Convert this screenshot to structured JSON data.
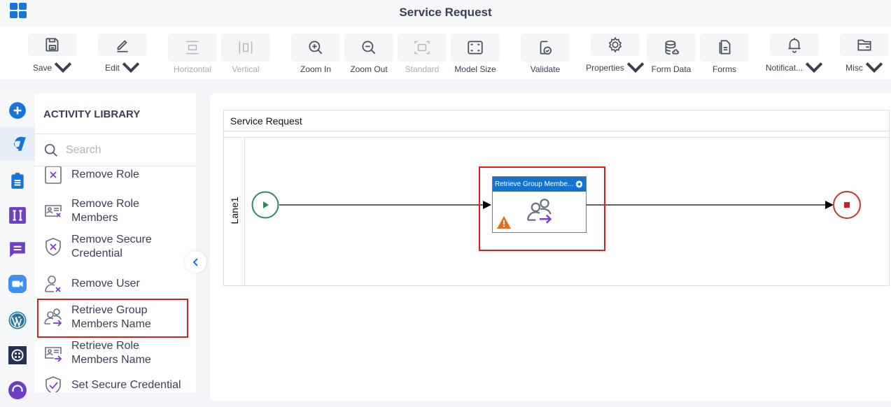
{
  "header": {
    "title": "Service Request",
    "logo_icon": "app-grid-icon"
  },
  "toolbar": {
    "buttons": [
      {
        "label": "Save",
        "icon": "save-icon",
        "dropdown": true,
        "disabled": false
      },
      {
        "label": "Edit",
        "icon": "edit-icon",
        "dropdown": true,
        "disabled": false
      },
      {
        "label": "Horizontal",
        "icon": "horizontal-layout-icon",
        "dropdown": false,
        "disabled": true
      },
      {
        "label": "Vertical",
        "icon": "vertical-layout-icon",
        "dropdown": false,
        "disabled": true
      },
      {
        "label": "Zoom In",
        "icon": "zoom-in-icon",
        "dropdown": false,
        "disabled": false
      },
      {
        "label": "Zoom Out",
        "icon": "zoom-out-icon",
        "dropdown": false,
        "disabled": false
      },
      {
        "label": "Standard",
        "icon": "standard-size-icon",
        "dropdown": false,
        "disabled": true
      },
      {
        "label": "Model Size",
        "icon": "model-size-icon",
        "dropdown": false,
        "disabled": false
      },
      {
        "label": "Validate",
        "icon": "validate-icon",
        "dropdown": false,
        "disabled": false
      },
      {
        "label": "Properties",
        "icon": "gear-icon",
        "dropdown": true,
        "disabled": false
      },
      {
        "label": "Form Data",
        "icon": "database-icon",
        "dropdown": false,
        "disabled": false
      },
      {
        "label": "Forms",
        "icon": "forms-icon",
        "dropdown": false,
        "disabled": false
      },
      {
        "label": "Notificat...",
        "icon": "bell-icon",
        "dropdown": true,
        "disabled": false
      },
      {
        "label": "Misc",
        "icon": "folder-icon",
        "dropdown": true,
        "disabled": false
      }
    ]
  },
  "left_rail": {
    "items": [
      {
        "name": "add-icon",
        "active": false
      },
      {
        "name": "activity-logo-icon",
        "active": true
      },
      {
        "name": "clipboard-icon",
        "active": false
      },
      {
        "name": "integration-icon",
        "active": false
      },
      {
        "name": "chat-icon",
        "active": false
      },
      {
        "name": "zoom-video-icon",
        "active": false
      },
      {
        "name": "wordpress-icon",
        "active": false
      },
      {
        "name": "twilio-icon",
        "active": false
      },
      {
        "name": "headset-icon",
        "active": false
      }
    ]
  },
  "library": {
    "title": "ACTIVITY LIBRARY",
    "search_placeholder": "Search",
    "items": [
      {
        "label": "Remove Role",
        "icon": "remove-role-icon"
      },
      {
        "label": "Remove Role Members",
        "icon": "remove-role-members-icon"
      },
      {
        "label": "Remove Secure Credential",
        "icon": "remove-credential-icon"
      },
      {
        "label": "Remove User",
        "icon": "remove-user-icon"
      },
      {
        "label": "Retrieve Group Members Name",
        "icon": "retrieve-group-members-icon",
        "highlighted": true
      },
      {
        "label": "Retrieve Role Members Name",
        "icon": "retrieve-role-members-icon"
      },
      {
        "label": "Set Secure Credential",
        "icon": "set-credential-icon"
      }
    ]
  },
  "canvas": {
    "pool_title": "Service Request",
    "lane_label": "Lane1",
    "task": {
      "title": "Retrieve Group Membe...",
      "has_warning": true
    },
    "colors": {
      "start": "#2e8b57",
      "end": "#c0392b",
      "task_header": "#1273d3",
      "warning": "#e07020",
      "highlight": "#e01b1b"
    }
  }
}
